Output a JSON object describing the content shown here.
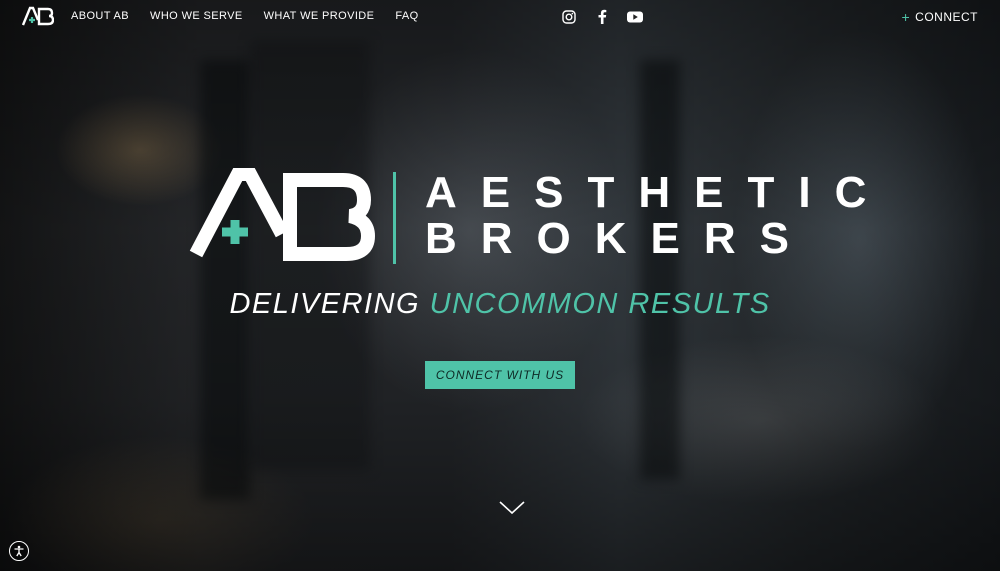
{
  "brand": {
    "logo_text": "AB",
    "name_line1": "AESTHETIC",
    "name_line2": "BROKERS"
  },
  "nav": {
    "items": [
      {
        "label": "ABOUT AB"
      },
      {
        "label": "WHO WE SERVE"
      },
      {
        "label": "WHAT WE PROVIDE"
      },
      {
        "label": "FAQ"
      }
    ],
    "social_icons": [
      "instagram-icon",
      "facebook-icon",
      "youtube-icon"
    ],
    "connect_label": "CONNECT"
  },
  "hero": {
    "tagline_part1": "DELIVERING ",
    "tagline_part2": "UNCOMMON RESULTS",
    "cta_label": "CONNECT WITH US"
  },
  "colors": {
    "accent": "#4fc3a8",
    "text": "#ffffff"
  },
  "icons": {
    "scroll": "chevron-down-icon",
    "accessibility": "accessibility-icon"
  }
}
